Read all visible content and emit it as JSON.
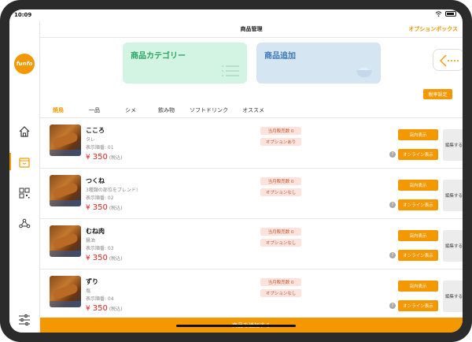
{
  "status": {
    "time": "10:09"
  },
  "brand": {
    "logo_text": "funfo"
  },
  "header": {
    "title": "商品管理",
    "option_box": "オプションボックス"
  },
  "cards": {
    "category": "商品カテゴリー",
    "add": "商品追加"
  },
  "rate_button": "税率設定",
  "tabs": [
    {
      "label": "焼鳥",
      "active": true
    },
    {
      "label": "一品",
      "active": false
    },
    {
      "label": "シメ",
      "active": false
    },
    {
      "label": "飲み物",
      "active": false
    },
    {
      "label": "ソフトドリンク",
      "active": false
    },
    {
      "label": "オススメ",
      "active": false
    }
  ],
  "items": [
    {
      "name": "こころ",
      "sauce": "タレ",
      "order": "表示順番: 01",
      "yen": "¥",
      "price": "350",
      "tax": "(税込)",
      "sales": "当月販売数 0",
      "option": "オプションあり",
      "store": "店内表示",
      "online": "オンライン表示",
      "edit": "編集する",
      "help": "?"
    },
    {
      "name": "つくね",
      "sauce": "3種類の部位をブレンド!",
      "order": "表示順番: 02",
      "yen": "¥",
      "price": "350",
      "tax": "(税込)",
      "sales": "当月販売数 0",
      "option": "オプションなし",
      "store": "店内表示",
      "online": "オンライン表示",
      "edit": "編集する",
      "help": "?"
    },
    {
      "name": "むね肉",
      "sauce": "醤油",
      "order": "表示順番: 03",
      "yen": "¥",
      "price": "350",
      "tax": "(税込)",
      "sales": "当月販売数 0",
      "option": "オプションなし",
      "store": "店内表示",
      "online": "オンライン表示",
      "edit": "編集する",
      "help": "?"
    },
    {
      "name": "ずり",
      "sauce": "塩",
      "order": "表示順番: 04",
      "yen": "¥",
      "price": "350",
      "tax": "(税込)",
      "sales": "当月販売数 0",
      "option": "オプションなし",
      "store": "店内表示",
      "online": "オンライン表示",
      "edit": "編集する",
      "help": "?"
    }
  ],
  "footer": {
    "add_product": "商品を追加する"
  },
  "colors": {
    "accent": "#f39800",
    "price": "#e02020",
    "category_card": "#d3f3e3",
    "add_card": "#d5e5f2"
  }
}
